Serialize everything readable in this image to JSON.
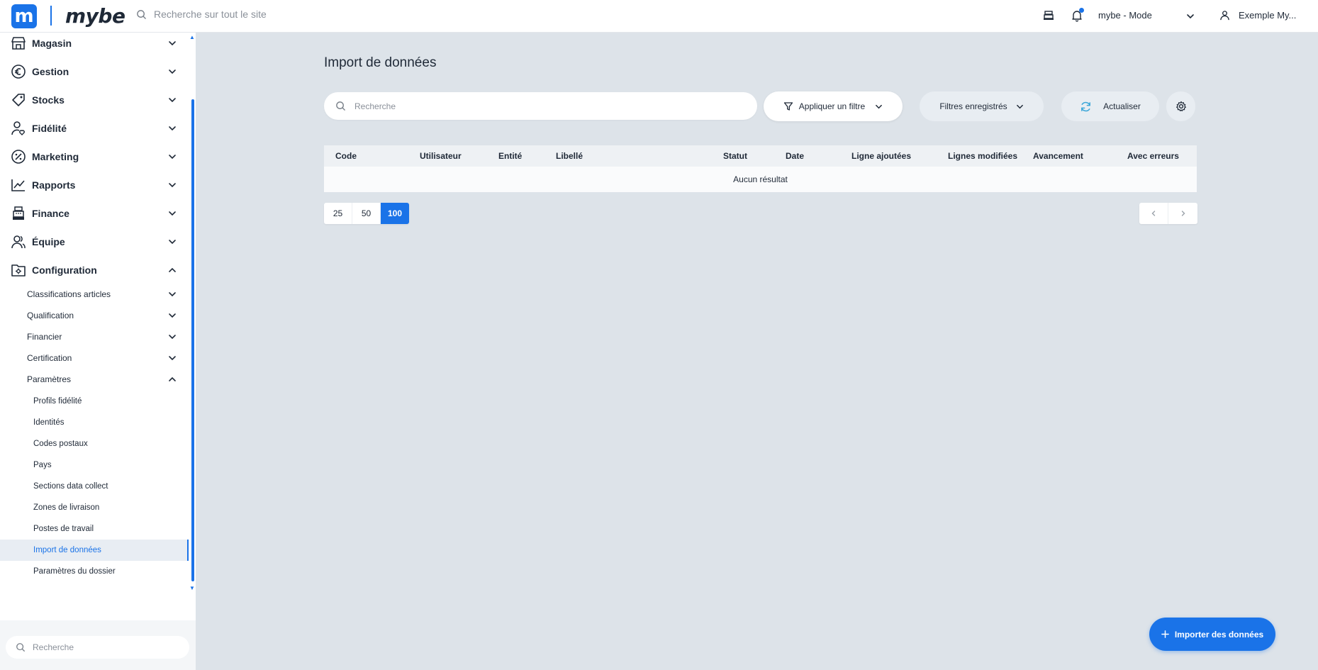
{
  "header": {
    "logo_letter": "m",
    "logo_text": "mybe",
    "search_placeholder": "Recherche sur tout le site",
    "store_selector": "mybe - Mode",
    "user_name": "Exemple My..."
  },
  "sidebar": {
    "main_items": [
      {
        "label": "Magasin",
        "icon": "store-icon"
      },
      {
        "label": "Gestion",
        "icon": "euro-icon"
      },
      {
        "label": "Stocks",
        "icon": "tag-icon"
      },
      {
        "label": "Fidélité",
        "icon": "user-heart-icon"
      },
      {
        "label": "Marketing",
        "icon": "percent-badge-icon"
      },
      {
        "label": "Rapports",
        "icon": "line-chart-icon"
      },
      {
        "label": "Finance",
        "icon": "cash-register-icon"
      },
      {
        "label": "Équipe",
        "icon": "team-icon"
      },
      {
        "label": "Configuration",
        "icon": "folder-gear-icon"
      }
    ],
    "config_sub_items": [
      {
        "label": "Classifications articles"
      },
      {
        "label": "Qualification"
      },
      {
        "label": "Financier"
      },
      {
        "label": "Certification"
      },
      {
        "label": "Paramètres"
      }
    ],
    "parametres_items": [
      {
        "label": "Profils fidélité"
      },
      {
        "label": "Identités"
      },
      {
        "label": "Codes postaux"
      },
      {
        "label": "Pays"
      },
      {
        "label": "Sections data collect"
      },
      {
        "label": "Zones de livraison"
      },
      {
        "label": "Postes de travail"
      },
      {
        "label": "Import de données",
        "active": true
      },
      {
        "label": "Paramètres du dossier"
      }
    ],
    "search_placeholder": "Recherche"
  },
  "main": {
    "title": "Import de données",
    "search_placeholder": "Recherche",
    "filter_button": "Appliquer un filtre",
    "saved_filters_button": "Filtres enregistrés",
    "refresh_button": "Actualiser",
    "table": {
      "columns": [
        "Code",
        "Utilisateur",
        "Entité",
        "Libellé",
        "Statut",
        "Date",
        "Ligne ajoutées",
        "Lignes modifiées",
        "Avancement",
        "Avec erreurs"
      ],
      "empty_text": "Aucun résultat"
    },
    "page_sizes": [
      "25",
      "50",
      "100"
    ],
    "selected_page_size": "100",
    "import_button": "Importer des données"
  },
  "colors": {
    "accent": "#1a73e8",
    "background": "#dde3e9",
    "sidebar_active_bg": "#e8edf3"
  }
}
